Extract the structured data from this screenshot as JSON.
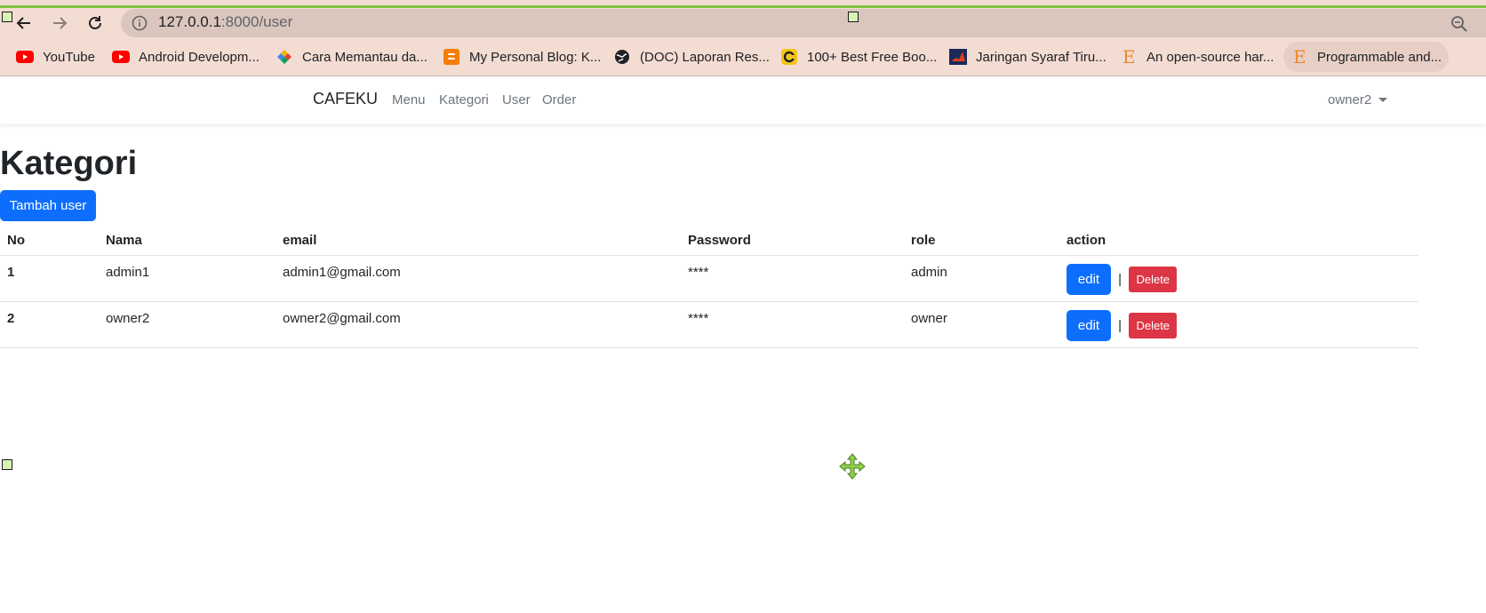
{
  "browser": {
    "url_host": "127.0.0.1",
    "url_rest": ":8000/user",
    "bookmarks": [
      {
        "label": "YouTube",
        "icon": "youtube-icon"
      },
      {
        "label": "Android Developm...",
        "icon": "youtube-icon"
      },
      {
        "label": "Cara Memantau da...",
        "icon": "diamond-logo-icon"
      },
      {
        "label": "My Personal Blog: K...",
        "icon": "blogger-icon"
      },
      {
        "label": "(DOC) Laporan Res...",
        "icon": "globe-icon"
      },
      {
        "label": "100+ Best Free Boo...",
        "icon": "c-logo-icon"
      },
      {
        "label": "Jaringan Syaraf Tiru...",
        "icon": "matlab-icon"
      },
      {
        "label": "An open-source har...",
        "icon": "e-logo-icon"
      },
      {
        "label": "Programmable and...",
        "icon": "e-logo-icon"
      }
    ]
  },
  "navbar": {
    "brand": "CAFEKU",
    "links": [
      "Menu",
      "Kategori",
      "User",
      "Order"
    ],
    "user": "owner2"
  },
  "page": {
    "title": "Kategori",
    "add_button": "Tambah user"
  },
  "table": {
    "headers": [
      "No",
      "Nama",
      "email",
      "Password",
      "role",
      "action"
    ],
    "rows": [
      {
        "no": "1",
        "nama": "admin1",
        "email": "admin1@gmail.com",
        "password": "****",
        "role": "admin",
        "edit": "edit",
        "sep": "|",
        "delete": "Delete"
      },
      {
        "no": "2",
        "nama": "owner2",
        "email": "owner2@gmail.com",
        "password": "****",
        "role": "owner",
        "edit": "edit",
        "sep": "|",
        "delete": "Delete"
      }
    ]
  },
  "colors": {
    "primary": "#0d6efd",
    "danger": "#dc3545",
    "chrome_bg": "#f3dcd2"
  }
}
